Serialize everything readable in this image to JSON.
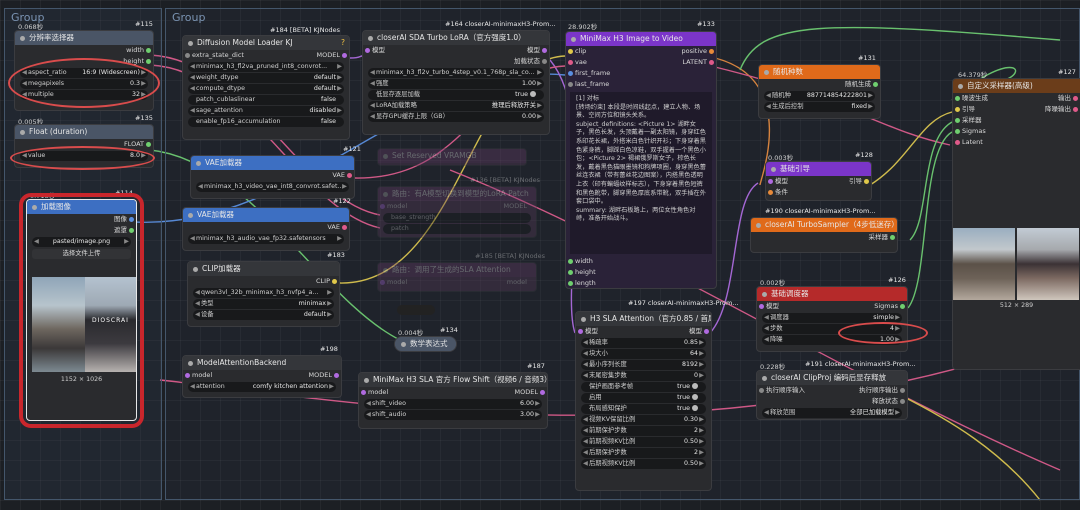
{
  "groups": {
    "left_title": "Group",
    "main_title": "Group"
  },
  "nodes": {
    "res_select": {
      "timing": "0.068秒",
      "id": "#115",
      "title": "分辨率选择器",
      "out_width": "width",
      "out_height": "height",
      "aspect_label": "aspect_ratio",
      "aspect_value": "16:9 (Widescreen)",
      "mp_label": "megapixels",
      "mp_value": "0.3",
      "mult_label": "multiple",
      "mult_value": "32"
    },
    "float": {
      "timing": "0.005秒",
      "id": "#135",
      "title": "Float (duration)",
      "out": "FLOAT",
      "value_label": "value",
      "value": "8.0"
    },
    "load_image": {
      "timing": "0.718秒",
      "id": "#114",
      "title": "加载图像",
      "out_image": "图像",
      "out_mask": "遮罩",
      "file": "pasted/image.png",
      "upload": "选择文件上传",
      "caption": "1152 × 1026",
      "photo_text": "DIOSCRAI"
    },
    "dm_loader": {
      "id": "#184 [BETA] KJNodes",
      "title": "Diffusion Model Loader KJ",
      "in_extra": "extra_state_dict",
      "out": "MODEL",
      "model_file": "minimax_h3_fl2va_pruned_int8_convrot...",
      "wd_label": "weight_dtype",
      "wd_value": "default",
      "cd_label": "compute_dtype",
      "cd_value": "default",
      "pc_label": "patch_cublaslinear",
      "pc_value": "false",
      "sa_label": "sage_attention",
      "sa_value": "disabled",
      "ef_label": "enable_fp16_accumulation",
      "ef_value": "false"
    },
    "turbo_lora": {
      "id": "#164 closerAI-minimaxH3-Prom...",
      "title": "closerAI SDA Turbo LoRA（官方强度1.0）",
      "in_model": "模型",
      "out_model": "模型",
      "out_state": "加载状态",
      "lora_file": "minimax_h3_fl2v_turbo_4step_v0.1_768p_sla_co...",
      "str_label": "强度",
      "str_value": "1.00",
      "low_label": "低显存逐层加载",
      "low_value": "true",
      "inf_label": "LoRA加载策略",
      "inf_value": "推理后释放开关",
      "gpu_label": "显存GPU缓存上限（GB）",
      "gpu_value": "0.00"
    },
    "vae_loader": {
      "id": "#121",
      "title": "VAE加载器",
      "out": "VAE",
      "file": "minimax_h3_video_vae_int8_convrot.safet..."
    },
    "vae_loader2": {
      "id": "#122",
      "title": "VAE加载器",
      "out": "VAE",
      "file": "minimax_h3_audio_vae_fp32.safetensors"
    },
    "clip_loader": {
      "id": "#183",
      "title": "CLIP加载器",
      "out": "CLIP",
      "file": "qwen3vl_32b_minimax_h3_nvfp4_a...",
      "type_label": "类型",
      "type_value": "minimax",
      "dev_label": "设备",
      "dev_value": "default"
    },
    "faded1": {
      "title": "Set Reserved VRAMGB",
      "id": "#136 [BETA] KJNodes"
    },
    "faded2": {
      "title": "路由：有A模型切换到模型的LoRA Patch",
      "in": "model",
      "out": "MODEL",
      "w1": "base_strength",
      "w2": "patch"
    },
    "faded3": {
      "title": "路由：调用了生成的SLA Attention",
      "id": "#185 [BETA] KJNodes",
      "in": "model",
      "out": "model"
    },
    "model_attn": {
      "id": "#198",
      "title": "ModelAttentionBackend",
      "in": "model",
      "out": "MODEL",
      "attn_label": "attention",
      "attn_value": "comfy kitchen attention"
    },
    "math_expr": {
      "timing": "0.004秒",
      "id": "#134",
      "title": "数学表达式"
    },
    "flow_shift": {
      "id": "#187",
      "title": "MiniMax H3 SLA 官方 Flow Shift（视频6 / 音频3）",
      "in": "model",
      "out": "MODEL",
      "sv_label": "shift_video",
      "sv_value": "6.00",
      "sa_label": "shift_audio",
      "sa_value": "3.00"
    },
    "i2v": {
      "timing": "28.902秒",
      "id": "#133",
      "title": "MiniMax H3 Image to Video",
      "in_clip": "clip",
      "in_vae": "vae",
      "in_first": "first_frame",
      "in_last": "last_frame",
      "out_pos": "positive",
      "out_lat": "LATENT",
      "prompt": "[1] 对标\n[转场约束] 本段是时间线起点，建立人物、场景、空间方位和镜头关系。\nsubject_definitions: <Picture 1> 湖畔女子，黑色长发，头顶戴着一副太阳镜，身穿红色系印花长裙，外搭米白色针织开衫；下身穿着黑色紧身裤，脚踩白色凉鞋，双手握着一个黑色小包；<Picture 2> 褐裙俄罗斯女子，棕色长发，戴着黑色猫眼墨镜和狗牌项圈，身穿黑色蕾丝连衣裙（带有蕾丝花边图案），内搭黑色透明上衣（印有蝙蝠纹样标志），下身穿着黑色短裤和黑色靴带，脚穿黑色厚底系带靴，双手插在外套口袋中。\nsummary: 湖畔石板路上，两位女性角色对峙，准备开始战斗。",
      "in_width": "width",
      "in_height": "height",
      "in_length": "length"
    },
    "sla_attn": {
      "id": "#197 closerAI-minimaxH3-Prom...",
      "title": "H3 SLA Attention（官方0.85 / 首尾保护）",
      "in": "模型",
      "out": "模型",
      "rows": [
        {
          "label": "稀疏率",
          "value": "0.85"
        },
        {
          "label": "块大小",
          "value": "64"
        },
        {
          "label": "最小序列长度",
          "value": "8192"
        },
        {
          "label": "末尾密集步数",
          "value": "0"
        },
        {
          "label": "保护画面参考帧",
          "value": "true"
        },
        {
          "label": "启用",
          "value": "true"
        },
        {
          "label": "布局感知保护",
          "value": "true"
        },
        {
          "label": "视频KV保留比例",
          "value": "0.30"
        },
        {
          "label": "前期保护步数",
          "value": "2"
        },
        {
          "label": "前期视频KV比例",
          "value": "0.50"
        },
        {
          "label": "后期保护步数",
          "value": "2"
        },
        {
          "label": "后期视频KV比例",
          "value": "0.50"
        }
      ]
    },
    "random_seed": {
      "id": "#131",
      "title": "随机种数",
      "out": "随机生成",
      "seed_label": "随机种",
      "seed_value": "887714854222801",
      "ctrl_label": "生成后控制",
      "ctrl_value": "fixed"
    },
    "basic_guide": {
      "timing": "0.003秒",
      "id": "#128",
      "title": "基础引导",
      "in_model": "模型",
      "in_cond": "条件",
      "out": "引导"
    },
    "turbo_sampler": {
      "id": "#190 closerAI-minimaxH3-Prom...",
      "title": "closerAI TurboSampler（4步低迷存）",
      "out": "采样器"
    },
    "basic_sched": {
      "timing": "0.002秒",
      "id": "#126",
      "title": "基础调度器",
      "in": "模型",
      "out": "Sigmas",
      "sch_label": "调度器",
      "sch_value": "simple",
      "steps_label": "步数",
      "steps_value": "4",
      "den_label": "降噪",
      "den_value": "1.00"
    },
    "clipproj": {
      "timing": "0.228秒",
      "id": "#191 closerAI-minimaxH3-Prom...",
      "title": "closerAI ClipProj 编码后显存释放",
      "in": "执行顺序输入",
      "out1": "执行顺序输出",
      "out2": "释放状态",
      "rel_label": "释放范围",
      "rel_value": "全部已加载模型"
    },
    "custom_sampler": {
      "timing": "64.379秒",
      "id": "#127",
      "title": "自定义采样器(高级)",
      "in1": "噪波生成",
      "in2": "引导",
      "in3": "采样器",
      "in4": "Sigmas",
      "in5": "Latent",
      "out1": "输出",
      "out2": "降噪输出",
      "caption": "512 × 289"
    }
  },
  "colors": {
    "accent_red": "#d94c4c",
    "wire_pink": "#e05a8a",
    "wire_green": "#6fcf6f",
    "wire_orange": "#e88a3a",
    "wire_blue": "#5a8fe0",
    "wire_yellow": "#e0c84a",
    "wire_purple": "#b06ae0"
  }
}
